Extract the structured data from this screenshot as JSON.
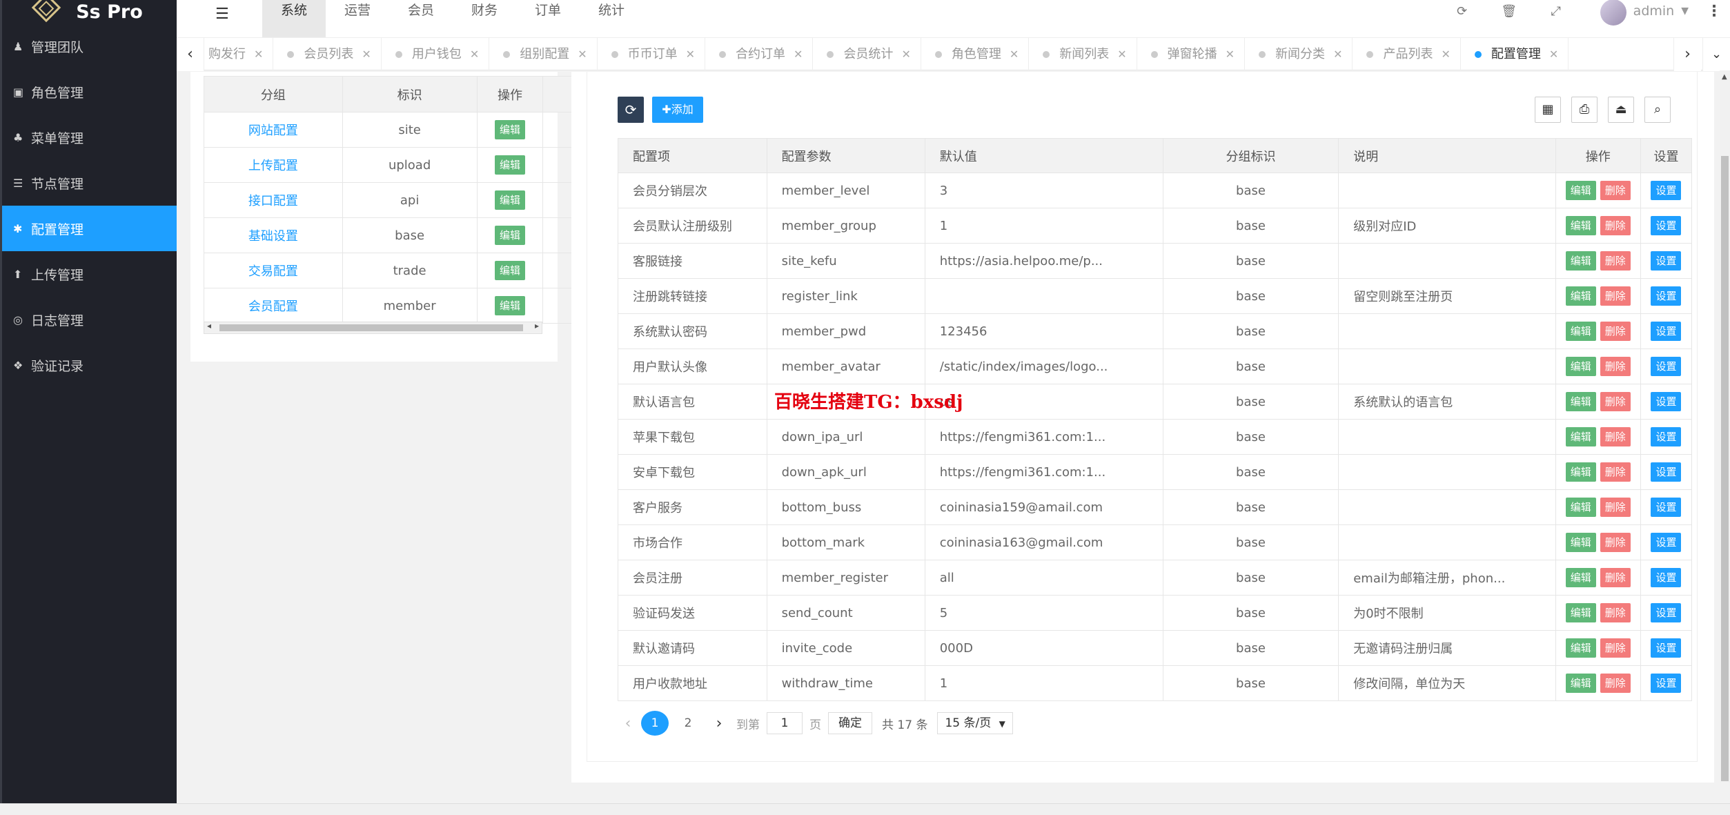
{
  "brand": {
    "name": "Ss Pro"
  },
  "sidebar": {
    "items": [
      {
        "icon": "♟",
        "label": "管理团队"
      },
      {
        "icon": "▣",
        "label": "角色管理"
      },
      {
        "icon": "♣",
        "label": "菜单管理"
      },
      {
        "icon": "☰",
        "label": "节点管理"
      },
      {
        "icon": "✱",
        "label": "配置管理",
        "active": true
      },
      {
        "icon": "⬆",
        "label": "上传管理"
      },
      {
        "icon": "◎",
        "label": "日志管理"
      },
      {
        "icon": "❖",
        "label": "验证记录"
      }
    ]
  },
  "topnav": [
    "系统",
    "运营",
    "会员",
    "财务",
    "订单",
    "统计"
  ],
  "user": {
    "name": "admin"
  },
  "tabs": [
    {
      "label": "购发行",
      "active": false
    },
    {
      "label": "会员列表",
      "active": false
    },
    {
      "label": "用户钱包",
      "active": false
    },
    {
      "label": "组别配置",
      "active": false
    },
    {
      "label": "币币订单",
      "active": false
    },
    {
      "label": "合约订单",
      "active": false
    },
    {
      "label": "会员统计",
      "active": false
    },
    {
      "label": "角色管理",
      "active": false
    },
    {
      "label": "新闻列表",
      "active": false
    },
    {
      "label": "弹窗轮播",
      "active": false
    },
    {
      "label": "新闻分类",
      "active": false
    },
    {
      "label": "产品列表",
      "active": false
    },
    {
      "label": "配置管理",
      "active": true
    }
  ],
  "group_table": {
    "headers": [
      "分组",
      "标识",
      "操作"
    ],
    "rows": [
      {
        "name": "网站配置",
        "key": "site"
      },
      {
        "name": "上传配置",
        "key": "upload"
      },
      {
        "name": "接口配置",
        "key": "api"
      },
      {
        "name": "基础设置",
        "key": "base"
      },
      {
        "name": "交易配置",
        "key": "trade"
      },
      {
        "name": "会员配置",
        "key": "member"
      }
    ],
    "edit_label": "编辑"
  },
  "toolbar": {
    "add_label": "✚添加"
  },
  "config_table": {
    "headers": [
      "配置项",
      "配置参数",
      "默认值",
      "分组标识",
      "说明",
      "操作",
      "设置"
    ],
    "rows": [
      {
        "item": "会员分销层次",
        "param": "member_level",
        "value": "3",
        "group": "base",
        "desc": ""
      },
      {
        "item": "会员默认注册级别",
        "param": "member_group",
        "value": "1",
        "group": "base",
        "desc": "级别对应ID"
      },
      {
        "item": "客服链接",
        "param": "site_kefu",
        "value": "https://asia.helpoo.me/p...",
        "group": "base",
        "desc": ""
      },
      {
        "item": "注册跳转链接",
        "param": "register_link",
        "value": "",
        "group": "base",
        "desc": "留空则跳至注册页"
      },
      {
        "item": "系统默认密码",
        "param": "member_pwd",
        "value": "123456",
        "group": "base",
        "desc": ""
      },
      {
        "item": "用户默认头像",
        "param": "member_avatar",
        "value": "/static/index/images/logo...",
        "group": "base",
        "desc": ""
      },
      {
        "item": "默认语言包",
        "param": "",
        "value": "us",
        "group": "base",
        "desc": "系统默认的语言包"
      },
      {
        "item": "苹果下载包",
        "param": "down_ipa_url",
        "value": "https://fengmi361.com:1...",
        "group": "base",
        "desc": ""
      },
      {
        "item": "安卓下载包",
        "param": "down_apk_url",
        "value": "https://fengmi361.com:1...",
        "group": "base",
        "desc": ""
      },
      {
        "item": "客户服务",
        "param": "bottom_buss",
        "value": "coininasia159@amail.com",
        "group": "base",
        "desc": ""
      },
      {
        "item": "市场合作",
        "param": "bottom_mark",
        "value": "coininasia163@gmail.com",
        "group": "base",
        "desc": ""
      },
      {
        "item": "会员注册",
        "param": "member_register",
        "value": "all",
        "group": "base",
        "desc": "email为邮箱注册，phon..."
      },
      {
        "item": "验证码发送",
        "param": "send_count",
        "value": "5",
        "group": "base",
        "desc": "为0时不限制"
      },
      {
        "item": "默认邀请码",
        "param": "invite_code",
        "value": "000D",
        "group": "base",
        "desc": "无邀请码注册归属"
      },
      {
        "item": "用户收款地址",
        "param": "withdraw_time",
        "value": "1",
        "group": "base",
        "desc": "修改间隔，单位为天"
      }
    ],
    "edit_label": "编辑",
    "delete_label": "删除",
    "set_label": "设置"
  },
  "pager": {
    "pages": [
      "1",
      "2"
    ],
    "current": "1",
    "goto_label": "到第",
    "page_input": "1",
    "page_unit": "页",
    "confirm_label": "确定",
    "total_label": "共 17 条",
    "page_size": "15 条/页"
  },
  "watermark": "百晓生搭建TG：bxsdj",
  "colors": {
    "sidebar_bg": "#20222a",
    "accent": "#1e9fff",
    "edit": "#5fb878",
    "delete": "#f37b7b",
    "refresh": "#2f4056"
  }
}
